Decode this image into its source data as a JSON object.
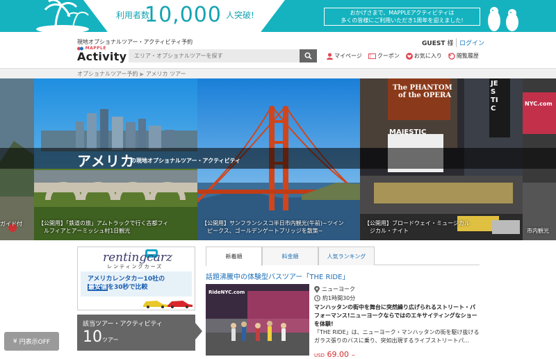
{
  "banner": {
    "label": "利用者数",
    "count": "10,000",
    "suffix": "人突破!",
    "message_line1": "おかげさまで、MAPPLEアクティビティは",
    "message_line2": "多くの皆様にご利用いただき1周年を迎えました!",
    "colors": {
      "bg": "#15b3bf",
      "count": "#15a3b2"
    }
  },
  "header": {
    "tagline": "現地オプショナルツアー・アクティビティ予約",
    "logo_small": "MAPPLE",
    "logo_big": "Activity",
    "search_placeholder": "エリア・オプショナルツアーを探す",
    "guest_name": "GUEST",
    "guest_suffix": "様",
    "login": "ログイン",
    "nav": {
      "mypage": "マイページ",
      "coupon": "クーポン",
      "favorites": "お気に入り",
      "history": "閲覧履歴"
    }
  },
  "breadcrumb": {
    "items": [
      "オプショナルツアー予約",
      "アメリカ ツアー"
    ]
  },
  "hero": {
    "title": "アメリカ",
    "subtitle": "の現地オプショナルツアー・アクティビティ",
    "edge_left_caption": "ガイド付",
    "panel1_caption_line1": "【公開用】「鉄道の旅」アムトラックで行く古都フィ",
    "panel1_caption_line2": "ルフィアとアーミッシュ村1日観光",
    "panel2_caption_line1": "【公開用】サンフランシスコ半日市内観光(午前)~ツイン",
    "panel2_caption_line2": "ピークス、ゴールデンゲートブリッジを散策~",
    "panel3_caption_line1": "【公開用】ブロードウェイ・ミュージカル",
    "panel3_caption_line2": "ジカル・ナイト",
    "edge_right_caption": "市内観光",
    "sign_phantom_1": "The PHANTOM",
    "sign_phantom_2": "of the OPERA",
    "sign_majestic": "MAJESTIC",
    "sign_vertical": "JESTIC",
    "sign_nyc": "NYC.com"
  },
  "sidebar": {
    "ad_logo": "rentingcarz",
    "ad_kana": "レンティングカーズ",
    "ad_line1_a": "アメリカレンタカー10社の",
    "ad_line2_a": "最安値",
    "ad_line2_b": "を30秒で比較",
    "count_label": "該当ツアー・アクティビティ",
    "count_value": "10",
    "count_unit": "ツアー"
  },
  "main": {
    "tabs": [
      {
        "label": "新着順",
        "active": true
      },
      {
        "label": "料金順",
        "active": false
      },
      {
        "label": "人気ランキング",
        "active": false
      }
    ],
    "featured": {
      "title": "話題沸騰中の体験型バスツアー「THE RIDE」",
      "location": "ニューヨーク",
      "duration": "約1時間30分",
      "headline": "マンハッタンの街中を舞台に突然繰り広げられるストリート・パフォーマンス!ニューヨークならではのエキサイティングなショーを体験!",
      "body": "「THE RIDE」は、ニューヨーク・マンハッタンの街を駆け抜けるガラス張りのバスに乗り、突如出現するライブストリートパ...",
      "price_currency": "USD",
      "price": "69.00",
      "price_suffix": "~",
      "image_sign": "RideNYC.com"
    }
  },
  "yen_toggle": "円表示OFF"
}
